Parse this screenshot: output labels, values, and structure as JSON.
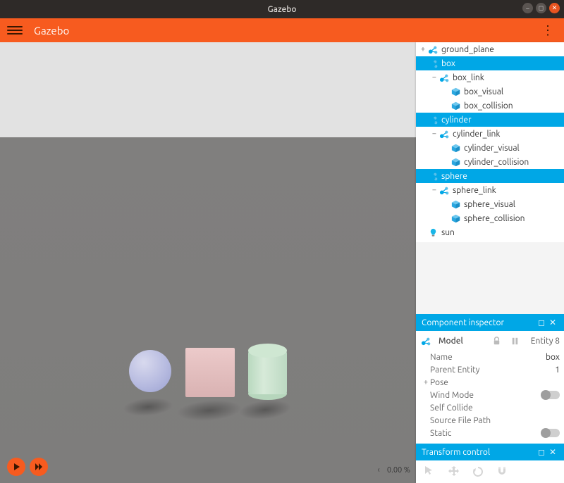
{
  "window": {
    "title": "Gazebo"
  },
  "appbar": {
    "title": "Gazebo"
  },
  "status": {
    "progress": "0.00 %"
  },
  "tree": {
    "items": [
      {
        "label": "ground_plane",
        "depth": 0,
        "icon": "model",
        "exp": "+",
        "sel": false
      },
      {
        "label": "box",
        "depth": 0,
        "icon": "model",
        "exp": "",
        "sel": true
      },
      {
        "label": "box_link",
        "depth": 1,
        "icon": "model",
        "exp": "−",
        "sel": false
      },
      {
        "label": "box_visual",
        "depth": 2,
        "icon": "cube",
        "exp": "",
        "sel": false
      },
      {
        "label": "box_collision",
        "depth": 2,
        "icon": "cube",
        "exp": "",
        "sel": false
      },
      {
        "label": "cylinder",
        "depth": 0,
        "icon": "model",
        "exp": "",
        "sel": true
      },
      {
        "label": "cylinder_link",
        "depth": 1,
        "icon": "model",
        "exp": "−",
        "sel": false
      },
      {
        "label": "cylinder_visual",
        "depth": 2,
        "icon": "cube",
        "exp": "",
        "sel": false
      },
      {
        "label": "cylinder_collision",
        "depth": 2,
        "icon": "cube",
        "exp": "",
        "sel": false
      },
      {
        "label": "sphere",
        "depth": 0,
        "icon": "model",
        "exp": "",
        "sel": true
      },
      {
        "label": "sphere_link",
        "depth": 1,
        "icon": "model",
        "exp": "−",
        "sel": false
      },
      {
        "label": "sphere_visual",
        "depth": 2,
        "icon": "cube",
        "exp": "",
        "sel": false
      },
      {
        "label": "sphere_collision",
        "depth": 2,
        "icon": "cube",
        "exp": "",
        "sel": false
      },
      {
        "label": "sun",
        "depth": 0,
        "icon": "light",
        "exp": "",
        "sel": false
      }
    ]
  },
  "inspector": {
    "title": "Component inspector",
    "type_label": "Model",
    "entity_label": "Entity 8",
    "rows": {
      "name": {
        "label": "Name",
        "value": "box"
      },
      "parent": {
        "label": "Parent Entity",
        "value": "1"
      },
      "pose": {
        "label": "Pose"
      },
      "wind": {
        "label": "Wind Mode"
      },
      "selfc": {
        "label": "Self Collide"
      },
      "src": {
        "label": "Source File Path"
      },
      "static": {
        "label": "Static"
      }
    }
  },
  "transform": {
    "title": "Transform control"
  }
}
